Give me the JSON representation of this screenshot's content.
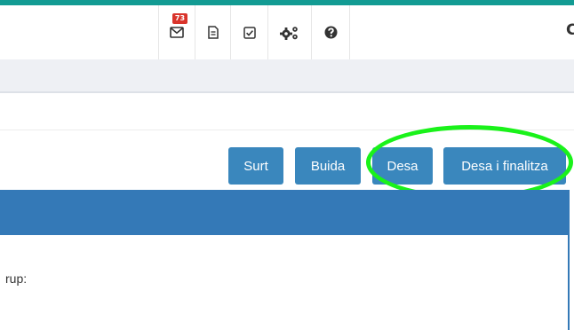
{
  "navbar": {
    "icons": [
      {
        "name": "mail-icon",
        "badge": "73"
      },
      {
        "name": "document-icon"
      },
      {
        "name": "checkbox-icon"
      },
      {
        "name": "gears-icon"
      },
      {
        "name": "help-icon"
      }
    ],
    "user_partial": "C"
  },
  "actions": {
    "exit_label": "Surt",
    "clear_label": "Buida",
    "save_label": "Desa",
    "save_finalize_label": "Desa i finalitza"
  },
  "form": {
    "group_label_partial": "rup:"
  },
  "colors": {
    "top_stripe": "#129b93",
    "button": "#3a87bd",
    "panel_header": "#3479b7",
    "highlight": "#1af21a",
    "badge": "#d9342b"
  }
}
